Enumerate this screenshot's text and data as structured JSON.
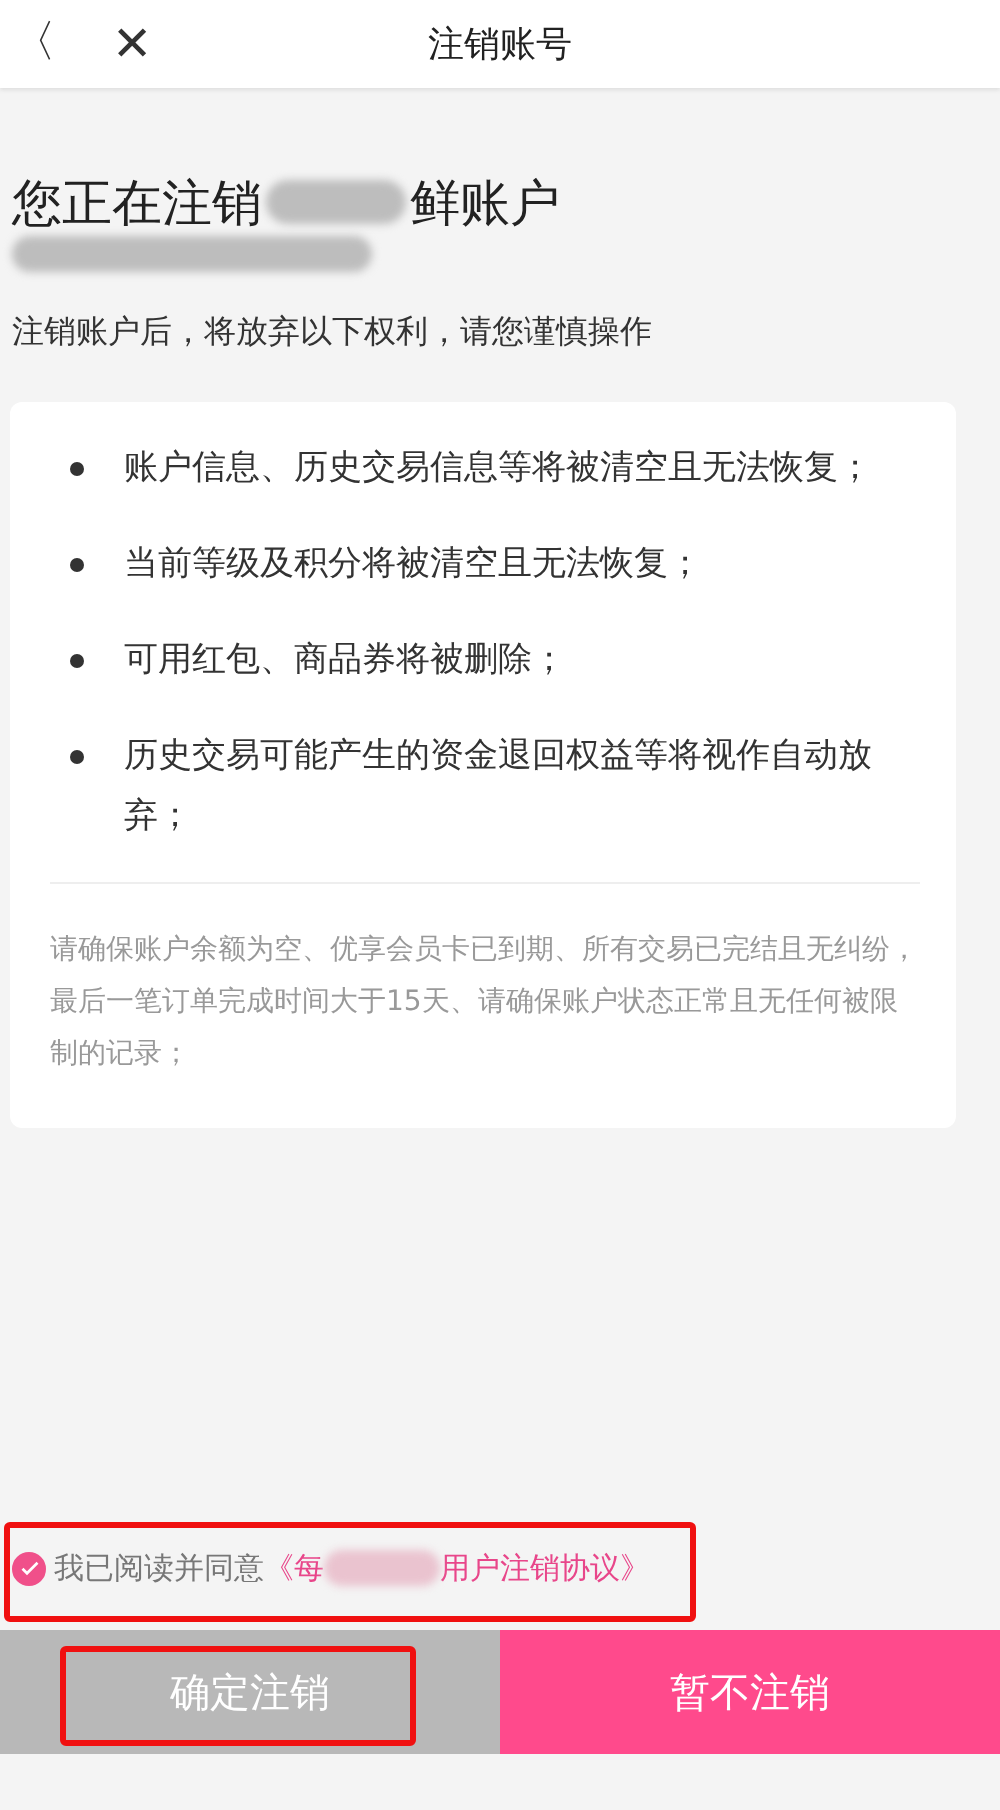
{
  "header": {
    "back": "〈",
    "close": "✕",
    "title": "注销账号"
  },
  "heading": {
    "start": "您正在注销",
    "end": "鲜账户"
  },
  "subtitle": "注销账户后，将放弃以下权利，请您谨慎操作",
  "rights": [
    "账户信息、历史交易信息等将被清空且无法恢复；",
    "当前等级及积分将被清空且无法恢复；",
    "可用红包、商品券将被删除；",
    "历史交易可能产生的资金退回权益等将视作自动放弃；"
  ],
  "note": "请确保账户余额为空、优享会员卡已到期、所有交易已完结且无纠纷，最后一笔订单完成时间大于15天、请确保账户状态正常且无任何被限制的记录；",
  "agreement": {
    "checked": true,
    "highlighted": true,
    "text": "我已阅读并同意",
    "link_start": "《每",
    "link_end": "用户注销协议》"
  },
  "buttons": [
    {
      "kind": "confirm",
      "label": "确定注销",
      "highlighted": true
    },
    {
      "kind": "cancel",
      "label": "暂不注销",
      "highlighted": false
    }
  ]
}
